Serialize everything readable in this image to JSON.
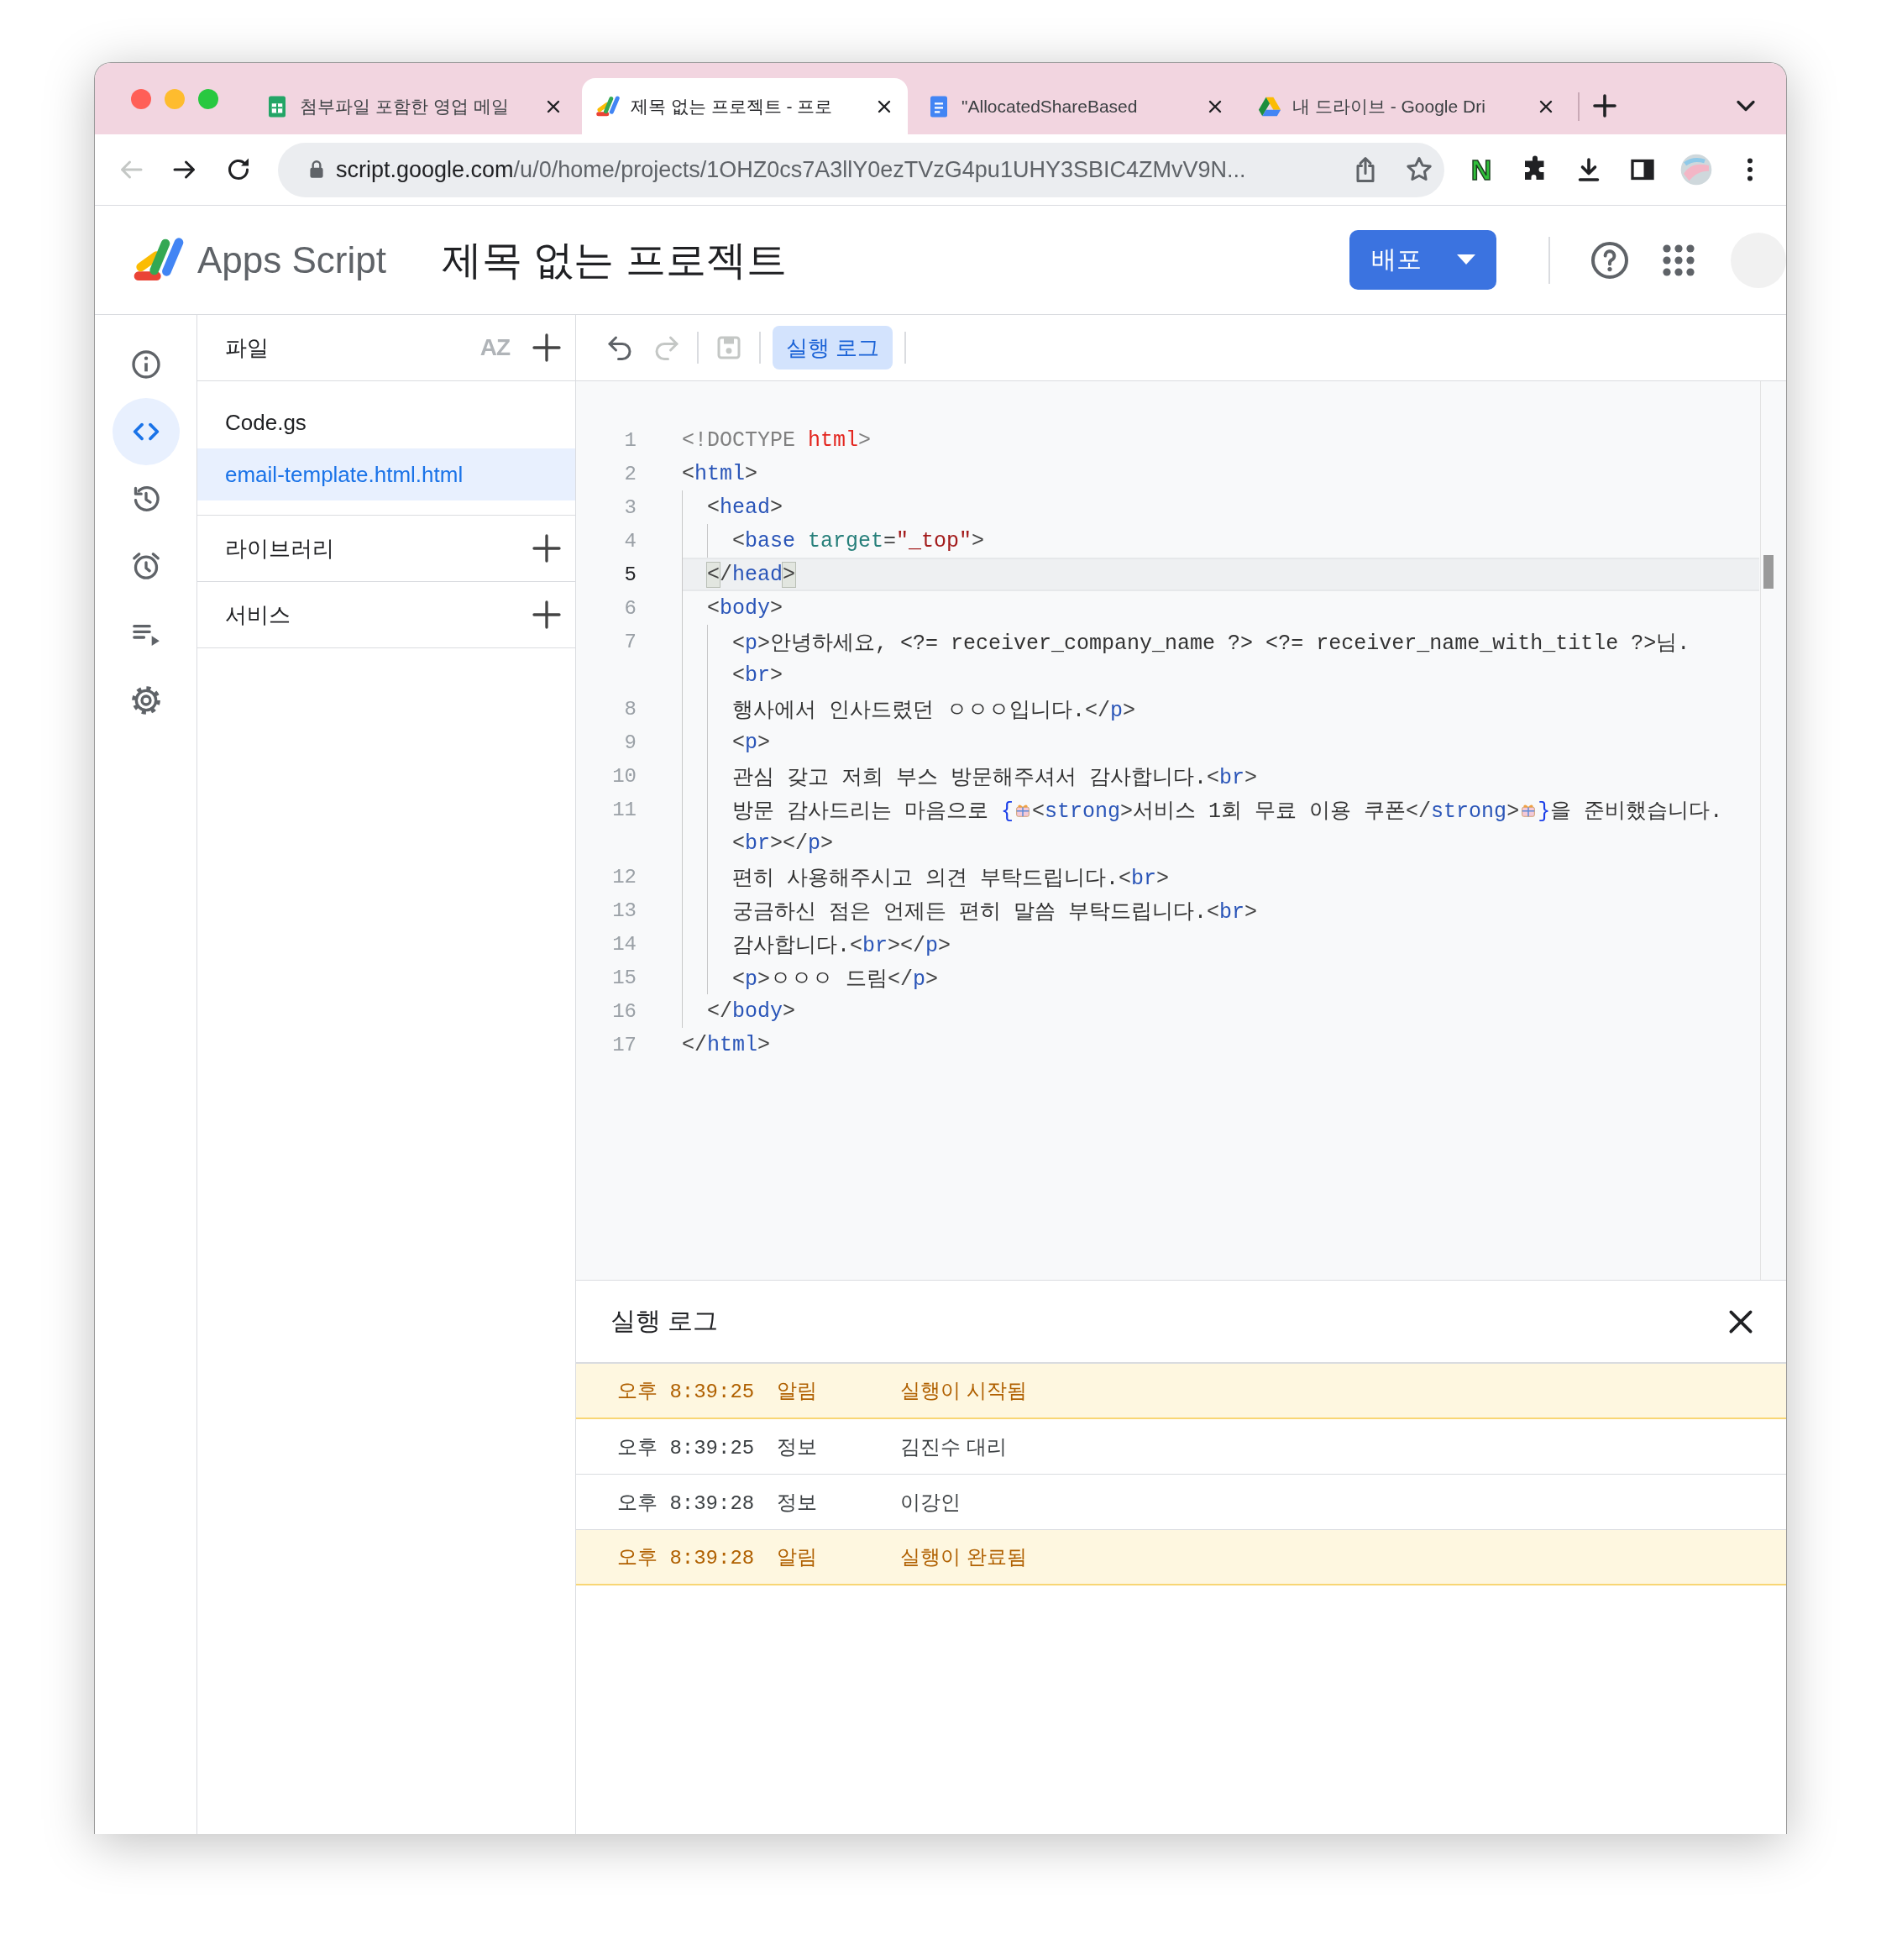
{
  "browser": {
    "tabs": [
      {
        "title": "첨부파일 포함한 영업 메일",
        "kind": "sheets",
        "selected": false
      },
      {
        "title": "제목 없는 프로젝트 - 프로",
        "kind": "apps-script",
        "selected": true
      },
      {
        "title": "\"AllocatedShareBased",
        "kind": "docs",
        "selected": false
      },
      {
        "title": "내 드라이브 - Google Dri",
        "kind": "drive",
        "selected": false
      }
    ],
    "back_button": {
      "disabled": true
    },
    "address": {
      "host": "script.google.com",
      "path": "/u/0/home/projects/1OHZ0cs7A3llY0ezTVzG4pu1UHY3SBIC4ZMvV9N..."
    },
    "extension_label": "N"
  },
  "app": {
    "name": "Apps Script",
    "project_title": "제목 없는 프로젝트",
    "deploy_button": "배포"
  },
  "rail": [
    {
      "kind": "info",
      "selected": false
    },
    {
      "kind": "code",
      "selected": true
    },
    {
      "kind": "history",
      "selected": false
    },
    {
      "kind": "triggers",
      "selected": false
    },
    {
      "kind": "executions",
      "selected": false
    },
    {
      "kind": "settings",
      "selected": false
    }
  ],
  "files_panel": {
    "title": "파일",
    "sort_label": "AZ",
    "files": [
      {
        "name": "Code.gs",
        "selected": false
      },
      {
        "name": "email-template.html.html",
        "selected": true
      }
    ],
    "sections": [
      {
        "title": "라이브러리"
      },
      {
        "title": "서비스"
      }
    ]
  },
  "toolbar": {
    "undo": {
      "disabled": false
    },
    "redo": {
      "disabled": true
    },
    "save": {
      "disabled": true
    },
    "log_button": {
      "label": "실행 로그",
      "selected": true
    }
  },
  "editor": {
    "lines": [
      {
        "number": "1",
        "current": false,
        "tokens": [
          {
            "kind": "doctype",
            "text": "<!DOCTYPE "
          },
          {
            "kind": "keyword",
            "text": "html"
          },
          {
            "kind": "doctype",
            "text": ">"
          }
        ]
      },
      {
        "number": "2",
        "current": false,
        "tokens": [
          {
            "kind": "punct",
            "text": "<"
          },
          {
            "kind": "tag",
            "text": "html"
          },
          {
            "kind": "punct",
            "text": ">"
          }
        ]
      },
      {
        "number": "3",
        "current": false,
        "tokens": [
          {
            "kind": "punct",
            "text": "  <"
          },
          {
            "kind": "tag",
            "text": "head"
          },
          {
            "kind": "punct",
            "text": ">"
          }
        ]
      },
      {
        "number": "4",
        "current": false,
        "tokens": [
          {
            "kind": "punct",
            "text": "    <"
          },
          {
            "kind": "tag",
            "text": "base"
          },
          {
            "kind": "attr",
            "text": " target"
          },
          {
            "kind": "punct",
            "text": "="
          },
          {
            "kind": "string",
            "text": "\"_top\""
          },
          {
            "kind": "punct",
            "text": ">"
          }
        ]
      },
      {
        "number": "5",
        "current": true,
        "tokens": [
          {
            "kind": "match",
            "text": "  <"
          },
          {
            "kind": "punct",
            "text": "/"
          },
          {
            "kind": "tag",
            "text": "head"
          },
          {
            "kind": "match",
            "text": ">"
          }
        ]
      },
      {
        "number": "6",
        "current": false,
        "tokens": [
          {
            "kind": "punct",
            "text": "  <"
          },
          {
            "kind": "tag",
            "text": "body"
          },
          {
            "kind": "punct",
            "text": ">"
          }
        ]
      },
      {
        "number": "7",
        "current": false,
        "tokens": [
          {
            "kind": "punct",
            "text": "    <"
          },
          {
            "kind": "tag",
            "text": "p"
          },
          {
            "kind": "punct",
            "text": ">"
          },
          {
            "kind": "text",
            "text": "안녕하세요, <?= receiver_company_name ?> <?= receiver_name_with_title ?>님."
          }
        ]
      },
      {
        "tokens": [
          {
            "kind": "punct",
            "text": "    <"
          },
          {
            "kind": "tag",
            "text": "br"
          },
          {
            "kind": "punct",
            "text": ">"
          }
        ]
      },
      {
        "number": "8",
        "current": false,
        "tokens": [
          {
            "kind": "text",
            "text": "    행사에서 인사드렸던 ㅇㅇㅇ입니다."
          },
          {
            "kind": "punct",
            "text": "</"
          },
          {
            "kind": "tag",
            "text": "p"
          },
          {
            "kind": "punct",
            "text": ">"
          }
        ]
      },
      {
        "number": "9",
        "current": false,
        "tokens": [
          {
            "kind": "punct",
            "text": "    <"
          },
          {
            "kind": "tag",
            "text": "p"
          },
          {
            "kind": "punct",
            "text": ">"
          }
        ]
      },
      {
        "number": "10",
        "current": false,
        "tokens": [
          {
            "kind": "text",
            "text": "    관심 갖고 저희 부스 방문해주셔서 감사합니다."
          },
          {
            "kind": "punct",
            "text": "<"
          },
          {
            "kind": "tag",
            "text": "br"
          },
          {
            "kind": "punct",
            "text": ">"
          }
        ]
      },
      {
        "number": "11",
        "current": false,
        "tokens": [
          {
            "kind": "text",
            "text": "    방문 감사드리는 마음으로 "
          },
          {
            "kind": "brace",
            "text": "{"
          },
          {
            "kind": "gift"
          },
          {
            "kind": "punct",
            "text": "<"
          },
          {
            "kind": "tag",
            "text": "strong"
          },
          {
            "kind": "punct",
            "text": ">"
          },
          {
            "kind": "text",
            "text": "서비스 1회 무료 이용 쿠폰"
          },
          {
            "kind": "punct",
            "text": "</"
          },
          {
            "kind": "tag",
            "text": "strong"
          },
          {
            "kind": "punct",
            "text": ">"
          },
          {
            "kind": "gift"
          },
          {
            "kind": "brace",
            "text": "}"
          },
          {
            "kind": "text",
            "text": "을 준비했습니다."
          }
        ]
      },
      {
        "tokens": [
          {
            "kind": "punct",
            "text": "    <"
          },
          {
            "kind": "tag",
            "text": "br"
          },
          {
            "kind": "punct",
            "text": "></"
          },
          {
            "kind": "tag",
            "text": "p"
          },
          {
            "kind": "punct",
            "text": ">"
          }
        ]
      },
      {
        "number": "12",
        "current": false,
        "tokens": [
          {
            "kind": "text",
            "text": "    편히 사용해주시고 의견 부탁드립니다."
          },
          {
            "kind": "punct",
            "text": "<"
          },
          {
            "kind": "tag",
            "text": "br"
          },
          {
            "kind": "punct",
            "text": ">"
          }
        ]
      },
      {
        "number": "13",
        "current": false,
        "tokens": [
          {
            "kind": "text",
            "text": "    궁금하신 점은 언제든 편히 말씀 부탁드립니다."
          },
          {
            "kind": "punct",
            "text": "<"
          },
          {
            "kind": "tag",
            "text": "br"
          },
          {
            "kind": "punct",
            "text": ">"
          }
        ]
      },
      {
        "number": "14",
        "current": false,
        "tokens": [
          {
            "kind": "text",
            "text": "    감사합니다."
          },
          {
            "kind": "punct",
            "text": "<"
          },
          {
            "kind": "tag",
            "text": "br"
          },
          {
            "kind": "punct",
            "text": "></"
          },
          {
            "kind": "tag",
            "text": "p"
          },
          {
            "kind": "punct",
            "text": ">"
          }
        ]
      },
      {
        "number": "15",
        "current": false,
        "tokens": [
          {
            "kind": "punct",
            "text": "    <"
          },
          {
            "kind": "tag",
            "text": "p"
          },
          {
            "kind": "punct",
            "text": ">"
          },
          {
            "kind": "text",
            "text": "ㅇㅇㅇ 드림"
          },
          {
            "kind": "punct",
            "text": "</"
          },
          {
            "kind": "tag",
            "text": "p"
          },
          {
            "kind": "punct",
            "text": ">"
          }
        ]
      },
      {
        "number": "16",
        "current": false,
        "tokens": [
          {
            "kind": "punct",
            "text": "  </"
          },
          {
            "kind": "tag",
            "text": "body"
          },
          {
            "kind": "punct",
            "text": ">"
          }
        ]
      },
      {
        "number": "17",
        "current": false,
        "tokens": [
          {
            "kind": "punct",
            "text": "</"
          },
          {
            "kind": "tag",
            "text": "html"
          },
          {
            "kind": "punct",
            "text": ">"
          }
        ]
      }
    ]
  },
  "log": {
    "title": "실행 로그",
    "rows": [
      {
        "time": "오후 8:39:25",
        "level": "알림",
        "message": "실행이 시작됨",
        "kind": "notice"
      },
      {
        "time": "오후 8:39:25",
        "level": "정보",
        "message": "김진수 대리",
        "kind": "info"
      },
      {
        "time": "오후 8:39:28",
        "level": "정보",
        "message": "이강인",
        "kind": "info"
      },
      {
        "time": "오후 8:39:28",
        "level": "알림",
        "message": "실행이 완료됨",
        "kind": "notice"
      }
    ]
  }
}
